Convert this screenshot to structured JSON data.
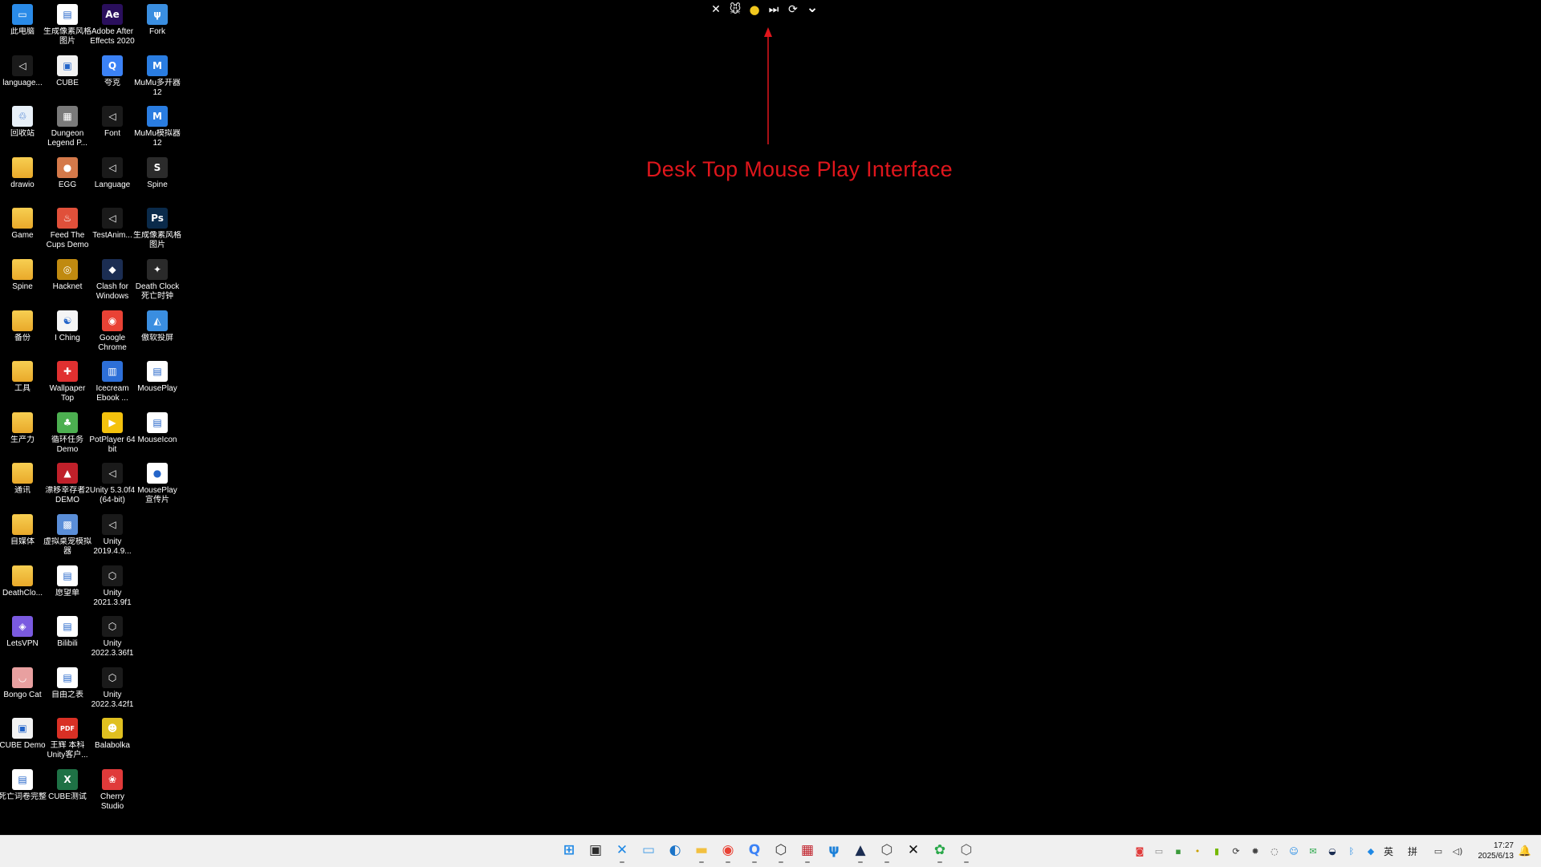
{
  "desktop": {
    "icons": [
      {
        "label": "此电脑",
        "icon": "computer-icon",
        "glyph": "▭",
        "color": "#2a8be8"
      },
      {
        "label": "生成像素风格图片",
        "icon": "document-icon",
        "glyph": "▤",
        "color": "#ffffff"
      },
      {
        "label": "Adobe After Effects 2020",
        "icon": "after-effects-icon",
        "glyph": "Ae",
        "color": "#2a0f5c"
      },
      {
        "label": "Fork",
        "icon": "fork-app-icon",
        "glyph": "ψ",
        "color": "#3a8ee0"
      },
      {
        "label": "language...",
        "icon": "unity-shortcut-icon",
        "glyph": "◁",
        "color": "#1a1a1a"
      },
      {
        "label": "CUBE",
        "icon": "cube-app-icon",
        "glyph": "▣",
        "color": "#f2f2f2"
      },
      {
        "label": "夸克",
        "icon": "quark-browser-icon",
        "glyph": "Q",
        "color": "#3b82f6"
      },
      {
        "label": "MuMu多开器12",
        "icon": "mumu-multi-icon",
        "glyph": "M",
        "color": "#2a7de1"
      },
      {
        "label": "回收站",
        "icon": "recycle-bin-icon",
        "glyph": "♲",
        "color": "#e8f0f8"
      },
      {
        "label": "Dungeon Legend P...",
        "icon": "dungeon-game-icon",
        "glyph": "▦",
        "color": "#7a7a7a"
      },
      {
        "label": "Font",
        "icon": "unity-shortcut-icon",
        "glyph": "◁",
        "color": "#1a1a1a"
      },
      {
        "label": "MuMu模拟器12",
        "icon": "mumu-emulator-icon",
        "glyph": "M",
        "color": "#2a7de1"
      },
      {
        "label": "drawio",
        "icon": "folder-icon",
        "glyph": "",
        "color": "#f2c040"
      },
      {
        "label": "EGG",
        "icon": "egg-icon",
        "glyph": "●",
        "color": "#d4794a"
      },
      {
        "label": "Language",
        "icon": "unity-shortcut-icon",
        "glyph": "◁",
        "color": "#1a1a1a"
      },
      {
        "label": "Spine",
        "icon": "spine-icon",
        "glyph": "S",
        "color": "#2b2b2b"
      },
      {
        "label": "Game",
        "icon": "folder-icon",
        "glyph": "",
        "color": "#f2c040"
      },
      {
        "label": "Feed The Cups Demo",
        "icon": "feed-cups-icon",
        "glyph": "♨",
        "color": "#e0503a"
      },
      {
        "label": "TestAnim...",
        "icon": "unity-shortcut-icon",
        "glyph": "◁",
        "color": "#1a1a1a"
      },
      {
        "label": "生成像素风格图片",
        "icon": "photoshop-icon",
        "glyph": "Ps",
        "color": "#0a2a4a"
      },
      {
        "label": "Spine",
        "icon": "folder-icon",
        "glyph": "",
        "color": "#f2c040"
      },
      {
        "label": "Hacknet",
        "icon": "hacknet-icon",
        "glyph": "◎",
        "color": "#c08a10"
      },
      {
        "label": "Clash for Windows",
        "icon": "clash-icon",
        "glyph": "◆",
        "color": "#1b2d52"
      },
      {
        "label": "Death Clock 死亡时钟",
        "icon": "death-clock-icon",
        "glyph": "✦",
        "color": "#2a2a2a"
      },
      {
        "label": "备份",
        "icon": "folder-icon",
        "glyph": "",
        "color": "#f2c040"
      },
      {
        "label": "I Ching",
        "icon": "i-ching-icon",
        "glyph": "☯",
        "color": "#f5f5f5"
      },
      {
        "label": "Google Chrome",
        "icon": "chrome-icon",
        "glyph": "◉",
        "color": "#e94235"
      },
      {
        "label": "傲软投屏",
        "icon": "apowermirror-icon",
        "glyph": "◭",
        "color": "#3a8ee0"
      },
      {
        "label": "工具",
        "icon": "folder-icon",
        "glyph": "",
        "color": "#f2c040"
      },
      {
        "label": "Wallpaper Top",
        "icon": "wallpaper-pin-icon",
        "glyph": "✚",
        "color": "#e03030"
      },
      {
        "label": "Icecream Ebook ...",
        "icon": "icecream-ebook-icon",
        "glyph": "▥",
        "color": "#2d6fd8"
      },
      {
        "label": "MousePlay",
        "icon": "document-icon",
        "glyph": "▤",
        "color": "#ffffff"
      },
      {
        "label": "生产力",
        "icon": "folder-icon",
        "glyph": "",
        "color": "#f2c040"
      },
      {
        "label": "循环任务 Demo",
        "icon": "loop-task-icon",
        "glyph": "♣",
        "color": "#4caf50"
      },
      {
        "label": "PotPlayer 64 bit",
        "icon": "potplayer-icon",
        "glyph": "▶",
        "color": "#f4c20d"
      },
      {
        "label": "MouseIcon",
        "icon": "document-icon",
        "glyph": "▤",
        "color": "#ffffff"
      },
      {
        "label": "通讯",
        "icon": "folder-icon",
        "glyph": "",
        "color": "#f2c040"
      },
      {
        "label": "漂移幸存者2 DEMO",
        "icon": "drift-survivor-icon",
        "glyph": "▲",
        "color": "#c0202a"
      },
      {
        "label": "Unity 5.3.0f4 (64-bit)",
        "icon": "unity-icon",
        "glyph": "◁",
        "color": "#1a1a1a"
      },
      {
        "label": "MousePlay 宣传片",
        "icon": "video-file-icon",
        "glyph": "●",
        "color": "#ffffff"
      },
      {
        "label": "自媒体",
        "icon": "folder-icon",
        "glyph": "",
        "color": "#f2c040"
      },
      {
        "label": "虚拟桌宠模拟器",
        "icon": "vpet-icon",
        "glyph": "▩",
        "color": "#5a8ed8"
      },
      {
        "label": "Unity 2019.4.9...",
        "icon": "unity-icon",
        "glyph": "◁",
        "color": "#1a1a1a"
      },
      {
        "label": "",
        "icon": "",
        "glyph": "",
        "color": ""
      },
      {
        "label": "DeathClo...",
        "icon": "folder-icon",
        "glyph": "",
        "color": "#f2c040"
      },
      {
        "label": "愿望单",
        "icon": "wishlist-doc-icon",
        "glyph": "▤",
        "color": "#ffffff"
      },
      {
        "label": "Unity 2021.3.9f1",
        "icon": "unity-hex-icon",
        "glyph": "⬡",
        "color": "#1a1a1a"
      },
      {
        "label": "",
        "icon": "",
        "glyph": "",
        "color": ""
      },
      {
        "label": "LetsVPN",
        "icon": "letsvpn-icon",
        "glyph": "◈",
        "color": "#7a5ae0"
      },
      {
        "label": "Bilibili",
        "icon": "bilibili-doc-icon",
        "glyph": "▤",
        "color": "#ffffff"
      },
      {
        "label": "Unity 2022.3.36f1",
        "icon": "unity-hex-icon",
        "glyph": "⬡",
        "color": "#1a1a1a"
      },
      {
        "label": "",
        "icon": "",
        "glyph": "",
        "color": ""
      },
      {
        "label": "Bongo Cat",
        "icon": "bongo-cat-icon",
        "glyph": "◡",
        "color": "#e8a0a0"
      },
      {
        "label": "自由之表",
        "icon": "free-doc-icon",
        "glyph": "▤",
        "color": "#ffffff"
      },
      {
        "label": "Unity 2022.3.42f1",
        "icon": "unity-hex-icon",
        "glyph": "⬡",
        "color": "#1a1a1a"
      },
      {
        "label": "",
        "icon": "",
        "glyph": "",
        "color": ""
      },
      {
        "label": "CUBE Demo",
        "icon": "cube-app-icon",
        "glyph": "▣",
        "color": "#f2f2f2"
      },
      {
        "label": "王辉 本科 Unity客户...",
        "icon": "pdf-icon",
        "glyph": "PDF",
        "color": "#d93025"
      },
      {
        "label": "Balabolka",
        "icon": "balabolka-icon",
        "glyph": "☻",
        "color": "#e0c020"
      },
      {
        "label": "",
        "icon": "",
        "glyph": "",
        "color": ""
      },
      {
        "label": "死亡词卷完整",
        "icon": "document-icon",
        "glyph": "▤",
        "color": "#ffffff"
      },
      {
        "label": "CUBE测试",
        "icon": "excel-icon",
        "glyph": "X",
        "color": "#1e7145"
      },
      {
        "label": "Cherry Studio",
        "icon": "cherry-studio-icon",
        "glyph": "❀",
        "color": "#e03a3a"
      }
    ]
  },
  "toolbar": {
    "buttons": [
      {
        "name": "close-button",
        "icon": "close-icon",
        "glyph": "✕"
      },
      {
        "name": "mouse-character-button",
        "icon": "mouse-character-icon",
        "glyph": "🐭"
      },
      {
        "name": "record-button",
        "icon": "record-dot-icon",
        "glyph": "●"
      },
      {
        "name": "next-button",
        "icon": "skip-next-icon",
        "glyph": "⏭"
      },
      {
        "name": "refresh-button",
        "icon": "refresh-icon",
        "glyph": "⟳"
      },
      {
        "name": "expand-button",
        "icon": "chevron-down-icon",
        "glyph": "⌄"
      }
    ]
  },
  "annotation": {
    "text": "Desk Top Mouse Play Interface",
    "color": "#e0161c"
  },
  "taskbar": {
    "apps": [
      {
        "name": "start",
        "icon": "windows-start-icon",
        "glyph": "⊞",
        "color": "#1e88e5",
        "running": false
      },
      {
        "name": "task-view",
        "icon": "task-view-icon",
        "glyph": "▣",
        "color": "#2b2b2b",
        "running": false
      },
      {
        "name": "vscode",
        "icon": "vscode-icon",
        "glyph": "✕",
        "color": "#1e88e5",
        "running": true
      },
      {
        "name": "tablet",
        "icon": "tablet-icon",
        "glyph": "▭",
        "color": "#4aa0e6",
        "running": false
      },
      {
        "name": "edge",
        "icon": "edge-icon",
        "glyph": "◐",
        "color": "#1a73c8",
        "running": false
      },
      {
        "name": "file-explorer",
        "icon": "file-explorer-icon",
        "glyph": "▬",
        "color": "#f2c040",
        "running": true
      },
      {
        "name": "chrome",
        "icon": "chrome-icon",
        "glyph": "◉",
        "color": "#e94235",
        "running": true
      },
      {
        "name": "quark",
        "icon": "quark-browser-icon",
        "glyph": "Q",
        "color": "#3b82f6",
        "running": true
      },
      {
        "name": "unity-hub",
        "icon": "unity-hub-icon",
        "glyph": "⬡",
        "color": "#333333",
        "running": true
      },
      {
        "name": "tools",
        "icon": "red-tool-icon",
        "glyph": "▦",
        "color": "#c0202a",
        "running": true
      },
      {
        "name": "fork",
        "icon": "fork-app-icon",
        "glyph": "ψ",
        "color": "#1a7fd8",
        "running": false
      },
      {
        "name": "cat",
        "icon": "black-cat-icon",
        "glyph": "▲",
        "color": "#1b2d52",
        "running": true
      },
      {
        "name": "unity",
        "icon": "unity-icon",
        "glyph": "⬡",
        "color": "#444444",
        "running": true
      },
      {
        "name": "capcut",
        "icon": "capcut-icon",
        "glyph": "✕",
        "color": "#111111",
        "running": false
      },
      {
        "name": "wechat-tool",
        "icon": "green-leaf-icon",
        "glyph": "✿",
        "color": "#2aa84a",
        "running": true
      },
      {
        "name": "unity-2",
        "icon": "unity-icon",
        "glyph": "⬡",
        "color": "#555555",
        "running": true
      }
    ],
    "tray": [
      {
        "icon": "red-app-tray-icon",
        "glyph": "◙",
        "color": "#e03a3a"
      },
      {
        "icon": "chat-tray-icon",
        "glyph": "▭",
        "color": "#888888"
      },
      {
        "icon": "green-app-tray-icon",
        "glyph": "▪",
        "color": "#3a9a3a"
      },
      {
        "icon": "yellow-tray-icon",
        "glyph": "•",
        "color": "#c9a000"
      },
      {
        "icon": "nvidia-tray-icon",
        "glyph": "▮",
        "color": "#76b900"
      },
      {
        "icon": "sync-tray-icon",
        "glyph": "⟳",
        "color": "#333333"
      },
      {
        "icon": "gear-tray-icon",
        "glyph": "✹",
        "color": "#444444"
      },
      {
        "icon": "eye-hidden-tray-icon",
        "glyph": "◌",
        "color": "#444444"
      },
      {
        "icon": "qq-tray-icon",
        "glyph": "☺",
        "color": "#1e88e5"
      },
      {
        "icon": "wechat-tray-icon",
        "glyph": "✉",
        "color": "#2aa84a"
      },
      {
        "icon": "steam-tray-icon",
        "glyph": "◒",
        "color": "#1b2d52"
      },
      {
        "icon": "bluetooth-icon",
        "glyph": "ᛒ",
        "color": "#1e88e5"
      },
      {
        "icon": "shield-icon",
        "glyph": "◆",
        "color": "#1e88e5"
      }
    ],
    "ime_primary": "英",
    "ime_secondary": "拼",
    "network_icon": "monitor-network-icon",
    "volume_icon": "volume-icon",
    "clock_time": "17:27",
    "clock_date": "2025/6/13",
    "notification_icon": "bell-icon"
  }
}
